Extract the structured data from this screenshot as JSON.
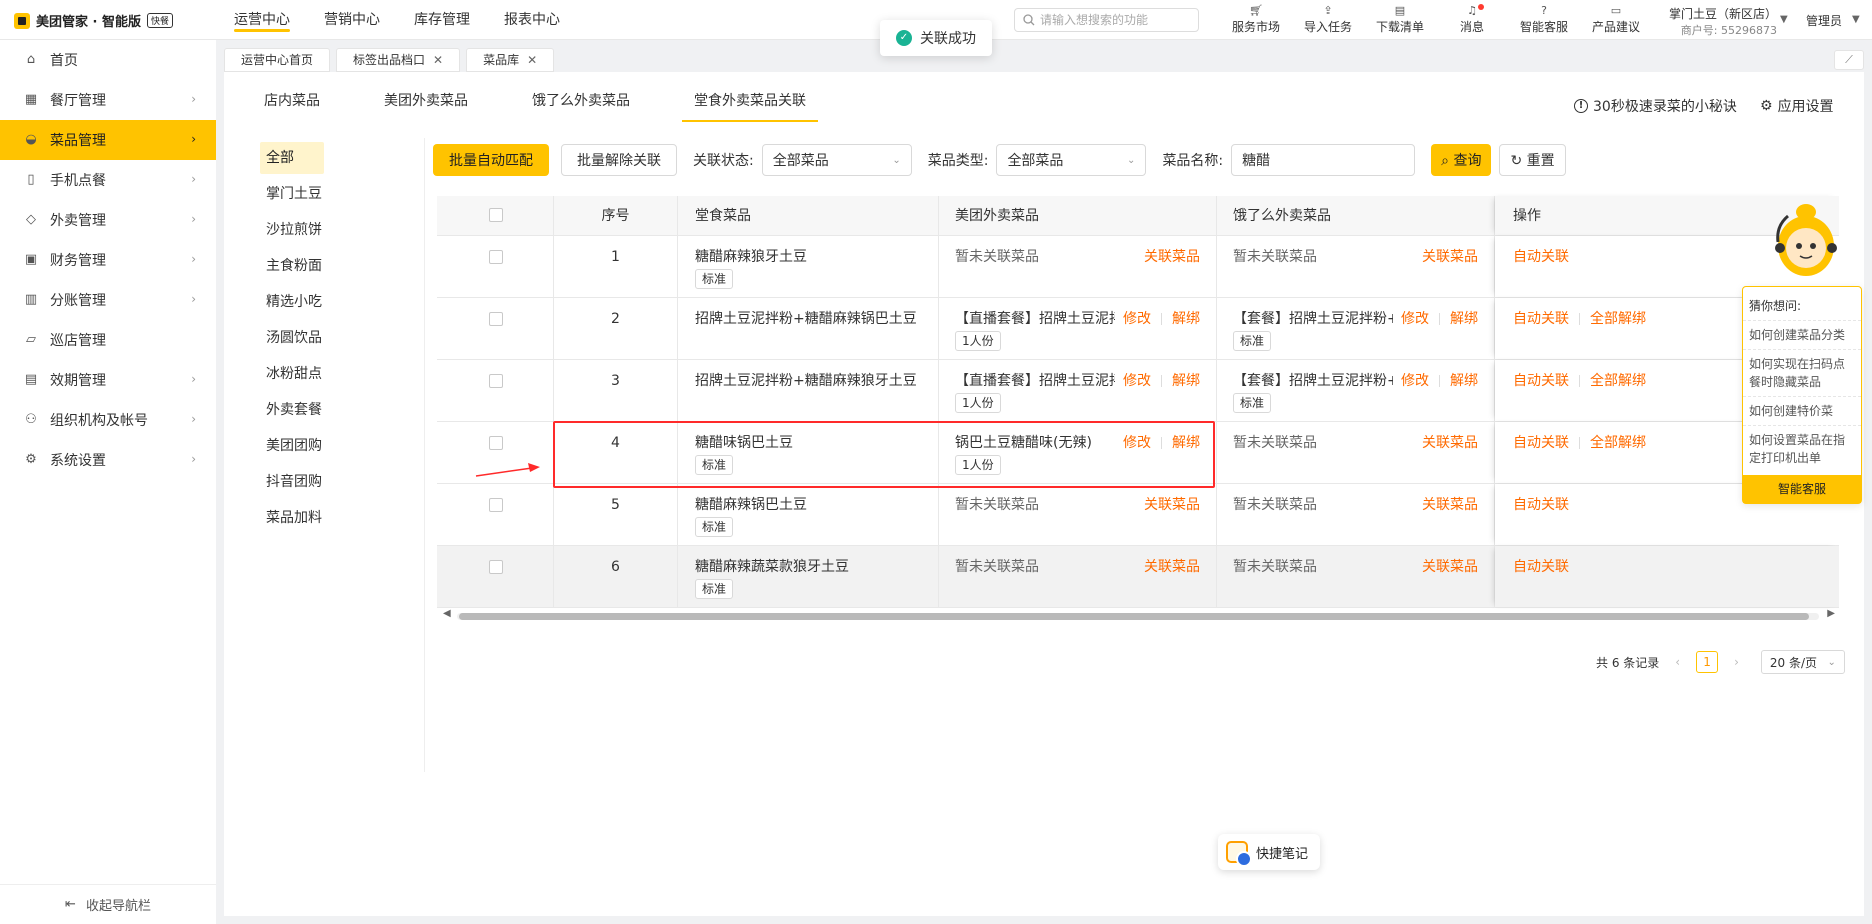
{
  "app": {
    "title": "美团管家 · 智能版",
    "badge": "快餐"
  },
  "topnav": [
    "运营中心",
    "营销中心",
    "库存管理",
    "报表中心"
  ],
  "search": {
    "placeholder": "请输入想搜索的功能"
  },
  "tools": [
    {
      "label": "服务市场",
      "icon": "cart-icon"
    },
    {
      "label": "导入任务",
      "icon": "import-icon"
    },
    {
      "label": "下载清单",
      "icon": "download-icon"
    },
    {
      "label": "消息",
      "icon": "bell-icon"
    },
    {
      "label": "智能客服",
      "icon": "help-icon"
    },
    {
      "label": "产品建议",
      "icon": "feedback-icon"
    }
  ],
  "store": {
    "name": "掌门土豆（新区店）",
    "merchant_id": "商户号: 55296873"
  },
  "user": {
    "role": "管理员"
  },
  "sidebar": {
    "items": [
      {
        "label": "首页",
        "icon": "home-icon"
      },
      {
        "label": "餐厅管理",
        "icon": "store-icon"
      },
      {
        "label": "菜品管理",
        "icon": "dish-icon"
      },
      {
        "label": "手机点餐",
        "icon": "tablet-icon"
      },
      {
        "label": "外卖管理",
        "icon": "delivery-icon"
      },
      {
        "label": "财务管理",
        "icon": "finance-icon"
      },
      {
        "label": "分账管理",
        "icon": "split-icon"
      },
      {
        "label": "巡店管理",
        "icon": "inspect-icon"
      },
      {
        "label": "效期管理",
        "icon": "calendar-icon"
      },
      {
        "label": "组织机构及帐号",
        "icon": "org-icon"
      },
      {
        "label": "系统设置",
        "icon": "gear-icon"
      }
    ],
    "collapse_label": "收起导航栏"
  },
  "pagetabs": [
    "运营中心首页",
    "标签出品档口",
    "菜品库"
  ],
  "subtabs": [
    "店内菜品",
    "美团外卖菜品",
    "饿了么外卖菜品",
    "堂食外卖菜品关联"
  ],
  "tips_label": "30秒极速录菜的小秘诀",
  "settings_label": "应用设置",
  "categories": [
    "全部",
    "掌门土豆",
    "沙拉煎饼",
    "主食粉面",
    "精选小吃",
    "汤圆饮品",
    "冰粉甜点",
    "外卖套餐",
    "美团团购",
    "抖音团购",
    "菜品加料"
  ],
  "filters": {
    "batch_match": "批量自动匹配",
    "batch_unlink": "批量解除关联",
    "status_label": "关联状态:",
    "status_value": "全部菜品",
    "type_label": "菜品类型:",
    "type_value": "全部菜品",
    "name_label": "菜品名称:",
    "name_value": "糖醋",
    "query": "查询",
    "reset": "重置"
  },
  "table": {
    "headers": {
      "no": "序号",
      "dish": "堂食菜品",
      "meituan": "美团外卖菜品",
      "eleme": "饿了么外卖菜品",
      "ops": "操作"
    },
    "rows": [
      {
        "no": "1",
        "dish": "糖醋麻辣狼牙土豆",
        "tag": "标准",
        "mt": "暂未关联菜品",
        "mt_tag": "",
        "mt_links": [
          "关联菜品"
        ],
        "el": "暂未关联菜品",
        "el_tag": "",
        "el_links": [
          "关联菜品"
        ],
        "ops": [
          "自动关联"
        ]
      },
      {
        "no": "2",
        "dish": "招牌土豆泥拌粉+糖醋麻辣锅巴土豆",
        "tag": "",
        "mt": "【直播套餐】招牌土豆泥拌...",
        "mt_tag": "1人份",
        "mt_links": [
          "修改",
          "解绑"
        ],
        "el": "【套餐】招牌土豆泥拌粉+...",
        "el_tag": "标准",
        "el_links": [
          "修改",
          "解绑"
        ],
        "ops": [
          "自动关联",
          "全部解绑"
        ]
      },
      {
        "no": "3",
        "dish": "招牌土豆泥拌粉+糖醋麻辣狼牙土豆",
        "tag": "",
        "mt": "【直播套餐】招牌土豆泥拌...",
        "mt_tag": "1人份",
        "mt_links": [
          "修改",
          "解绑"
        ],
        "el": "【套餐】招牌土豆泥拌粉+...",
        "el_tag": "标准",
        "el_links": [
          "修改",
          "解绑"
        ],
        "ops": [
          "自动关联",
          "全部解绑"
        ]
      },
      {
        "no": "4",
        "dish": "糖醋味锅巴土豆",
        "tag": "标准",
        "mt": "锅巴土豆糖醋味(无辣)",
        "mt_tag": "1人份",
        "mt_links": [
          "修改",
          "解绑"
        ],
        "el": "暂未关联菜品",
        "el_tag": "",
        "el_links": [
          "关联菜品"
        ],
        "ops": [
          "自动关联",
          "全部解绑"
        ]
      },
      {
        "no": "5",
        "dish": "糖醋麻辣锅巴土豆",
        "tag": "标准",
        "mt": "暂未关联菜品",
        "mt_tag": "",
        "mt_links": [
          "关联菜品"
        ],
        "el": "暂未关联菜品",
        "el_tag": "",
        "el_links": [
          "关联菜品"
        ],
        "ops": [
          "自动关联"
        ]
      },
      {
        "no": "6",
        "dish": "糖醋麻辣蔬菜款狼牙土豆",
        "tag": "标准",
        "mt": "暂未关联菜品",
        "mt_tag": "",
        "mt_links": [
          "关联菜品"
        ],
        "el": "暂未关联菜品",
        "el_tag": "",
        "el_links": [
          "关联菜品"
        ],
        "ops": [
          "自动关联"
        ]
      }
    ]
  },
  "pager": {
    "total": "共 6 条记录",
    "page": "1",
    "size": "20 条/页"
  },
  "toast": "关联成功",
  "helper": {
    "title": "猜你想问:",
    "questions": [
      "如何创建菜品分类",
      "如何实现在扫码点餐时隐藏菜品",
      "如何创建特价菜",
      "如何设置菜品在指定打印机出单"
    ],
    "footer": "智能客服"
  },
  "note_label": "快捷笔记",
  "colors": {
    "accent": "#ffc300",
    "link": "#ff6a00",
    "highlight": "#ff2a2a"
  }
}
